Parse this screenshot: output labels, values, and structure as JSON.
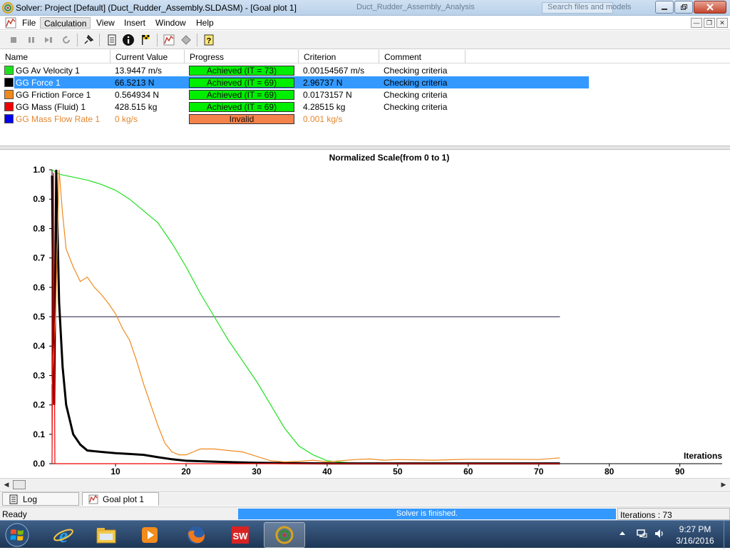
{
  "window": {
    "title": "Solver: Project [Default] (Duct_Rudder_Assembly.SLDASM) - [Goal plot 1]",
    "ghost_title": "Duct_Rudder_Assembly_Analysis",
    "ghost_search": "Search files and models"
  },
  "menu": {
    "items": [
      "File",
      "Calculation",
      "View",
      "Insert",
      "Window",
      "Help"
    ],
    "active": "Calculation"
  },
  "toolbar": {
    "icons": [
      "stop-icon",
      "pause-icon",
      "step-icon",
      "refresh-icon",
      "pin-icon",
      "sheet-icon",
      "info-icon",
      "finish-flag-icon",
      "goal-plot-icon",
      "preview-icon",
      "help-icon"
    ]
  },
  "goals_table": {
    "columns": [
      "Name",
      "Current Value",
      "Progress",
      "Criterion",
      "Comment"
    ],
    "rows": [
      {
        "name": "GG Av Velocity 1",
        "value": "13.9447 m/s",
        "progress": "Achieved (IT = 73)",
        "criterion": "0.00154567 m/s",
        "comment": "Checking criteria",
        "color": "#1ee11e",
        "progress_color": "#00ee00"
      },
      {
        "name": "GG Force 1",
        "value": "66.5213 N",
        "progress": "Achieved (IT = 69)",
        "criterion": "2.96737 N",
        "comment": "Checking criteria",
        "color": "#000000",
        "progress_color": "#00ee00",
        "selected": true
      },
      {
        "name": "GG Friction Force 1",
        "value": "0.564934 N",
        "progress": "Achieved (IT = 69)",
        "criterion": "0.0173157 N",
        "comment": "Checking criteria",
        "color": "#f08a1c",
        "progress_color": "#00ee00"
      },
      {
        "name": "GG Mass (Fluid) 1",
        "value": "428.515 kg",
        "progress": "Achieved (IT = 69)",
        "criterion": "4.28515 kg",
        "comment": "Checking criteria",
        "color": "#ee0000",
        "progress_color": "#00ee00"
      },
      {
        "name": "GG Mass Flow Rate 1",
        "value": "0 kg/s",
        "progress": "Invalid",
        "criterion": "0.001 kg/s",
        "comment": "",
        "color": "#0000ee",
        "progress_color": "#f5824a",
        "invalid": true
      }
    ]
  },
  "chart_data": {
    "type": "line",
    "title": "Normalized Scale(from 0 to 1)",
    "xlabel": "Iterations",
    "ylabel": "",
    "xlim": [
      1,
      96
    ],
    "ylim": [
      0,
      1
    ],
    "x_ticks": [
      10,
      20,
      30,
      40,
      50,
      60,
      70,
      80,
      90
    ],
    "y_ticks": [
      "0.0",
      "0.1",
      "0.2",
      "0.3",
      "0.4",
      "0.5",
      "0.6",
      "0.7",
      "0.8",
      "0.9",
      "1.0"
    ],
    "reference_line": {
      "y": 0.5,
      "x_end": 73
    },
    "series": [
      {
        "name": "GG Av Velocity 1",
        "color": "#1ee11e",
        "x": [
          1,
          2,
          4,
          6,
          8,
          10,
          12,
          14,
          16,
          18,
          20,
          22,
          24,
          26,
          28,
          30,
          32,
          34,
          36,
          38,
          40,
          42,
          44,
          50,
          60,
          73
        ],
        "y": [
          1.0,
          0.985,
          0.975,
          0.965,
          0.95,
          0.93,
          0.9,
          0.86,
          0.82,
          0.75,
          0.67,
          0.58,
          0.5,
          0.42,
          0.35,
          0.28,
          0.2,
          0.12,
          0.06,
          0.03,
          0.01,
          0.005,
          0.002,
          0.001,
          0.001,
          0.001
        ]
      },
      {
        "name": "GG Force 1",
        "color": "#000000",
        "x": [
          1,
          1.3,
          1.6,
          2,
          2.5,
          3,
          4,
          5,
          6,
          8,
          10,
          12,
          14,
          16,
          18,
          20,
          25,
          30,
          40,
          50,
          60,
          73
        ],
        "y": [
          0.98,
          0.2,
          1.0,
          0.55,
          0.33,
          0.2,
          0.1,
          0.065,
          0.045,
          0.04,
          0.036,
          0.033,
          0.03,
          0.022,
          0.015,
          0.01,
          0.006,
          0.003,
          0.001,
          0.001,
          0.001,
          0.001
        ]
      },
      {
        "name": "GG Friction Force 1",
        "color": "#f08a1c",
        "x": [
          1,
          1.5,
          2,
          2.5,
          3,
          4,
          5,
          6,
          7,
          8,
          9,
          10,
          11,
          12,
          13,
          14,
          15,
          16,
          17,
          18,
          19,
          20,
          21,
          22,
          24,
          26,
          28,
          30,
          32,
          34,
          36,
          38,
          40,
          42,
          44,
          46,
          48,
          50,
          55,
          60,
          65,
          70,
          73
        ],
        "y": [
          0.27,
          0.5,
          1.0,
          0.85,
          0.73,
          0.67,
          0.62,
          0.635,
          0.6,
          0.575,
          0.545,
          0.51,
          0.46,
          0.42,
          0.35,
          0.27,
          0.2,
          0.13,
          0.07,
          0.04,
          0.03,
          0.03,
          0.04,
          0.05,
          0.05,
          0.045,
          0.04,
          0.025,
          0.01,
          0.006,
          0.008,
          0.012,
          0.006,
          0.01,
          0.014,
          0.016,
          0.012,
          0.014,
          0.012,
          0.015,
          0.015,
          0.014,
          0.02
        ]
      },
      {
        "name": "GG Mass (Fluid) 1",
        "color": "#ee0000",
        "x": [
          1,
          1.2,
          1.4,
          2,
          73
        ],
        "y": [
          0.0,
          0.99,
          0.0,
          0.0,
          0.0
        ]
      }
    ]
  },
  "doctabs": [
    "Log",
    "Goal plot 1"
  ],
  "status": {
    "ready": "Ready",
    "solver": "Solver is finished.",
    "iterations": "Iterations : 73"
  },
  "taskbar": {
    "clock_time": "9:27 PM",
    "clock_date": "3/16/2016"
  }
}
